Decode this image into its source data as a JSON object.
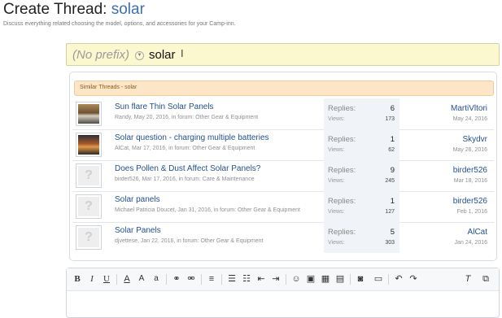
{
  "header": {
    "title_prefix": "Create Thread:",
    "title_term": "solar",
    "description": "Discuss everything related choosing the model, options, and accessories for your Camp-inn."
  },
  "title_field": {
    "prefix_label": "(No prefix)",
    "value": "solar"
  },
  "similar_threads": {
    "header": "Similar Threads - solar",
    "replies_label": "Replies:",
    "views_label": "Views:",
    "items": [
      {
        "title": "Sun flare Thin Solar Panels",
        "meta": "Randy, May 20, 2016, in forum: Other Gear & Equipment",
        "replies": "6",
        "views": "173",
        "last_user": "MartiVltori",
        "last_date": "May 24, 2016",
        "avatar": "photo"
      },
      {
        "title": "Solar question - charging multiple batteries",
        "meta": "AlCat, Mar 17, 2016, in forum: Other Gear & Equipment",
        "replies": "1",
        "views": "62",
        "last_user": "Skydvr",
        "last_date": "May 26, 2016",
        "avatar": "photo"
      },
      {
        "title": "Does Pollen & Dust Affect Solar Panels?",
        "meta": "birder526, Mar 17, 2016, in forum: Care & Maintenance",
        "replies": "9",
        "views": "245",
        "last_user": "birder526",
        "last_date": "Mar 18, 2016",
        "avatar": "default"
      },
      {
        "title": "Solar panels",
        "meta": "Michael Patricia Doucet, Jan 31, 2016, in forum: Other Gear & Equipment",
        "replies": "1",
        "views": "127",
        "last_user": "birder526",
        "last_date": "Feb 1, 2016",
        "avatar": "default"
      },
      {
        "title": "Solar Panels",
        "meta": "djvettese, Jan 22, 2016, in forum: Other Gear & Equipment",
        "replies": "5",
        "views": "303",
        "last_user": "AlCat",
        "last_date": "Jan 24, 2016",
        "avatar": "default"
      }
    ]
  },
  "toolbar": {
    "bold": "B",
    "italic": "I",
    "underline": "U",
    "text_color": "A",
    "font_size": "A",
    "font_family": "a",
    "clear_format": "T",
    "icons": [
      "bold-icon",
      "italic-icon",
      "underline-icon",
      "text-color-icon",
      "font-size-icon",
      "font-family-icon",
      "link-icon",
      "unlink-icon",
      "align-icon",
      "bullet-list-icon",
      "numbered-list-icon",
      "outdent-icon",
      "indent-icon",
      "smilie-icon",
      "image-icon",
      "media-icon",
      "insert-icon",
      "camera-icon",
      "save-draft-icon",
      "undo-icon",
      "redo-icon",
      "remove-format-icon",
      "toggle-bbcode-icon"
    ]
  }
}
